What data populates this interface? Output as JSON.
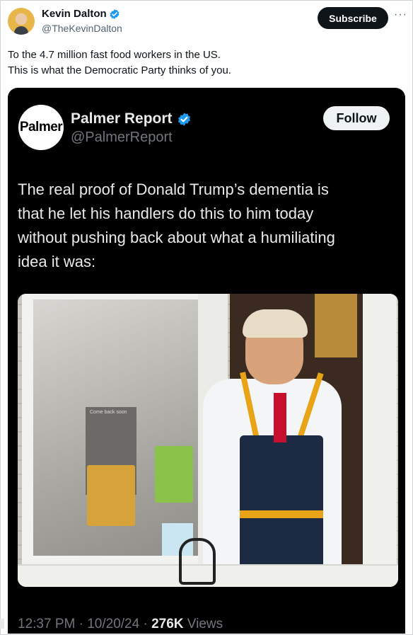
{
  "post": {
    "author": {
      "name": "Kevin Dalton",
      "handle": "@TheKevinDalton"
    },
    "subscribe_label": "Subscribe",
    "more_label": "···",
    "text_lines": [
      "To the 4.7 million fast food workers in the US.",
      "This is what the Democratic Party thinks of you."
    ]
  },
  "quoted": {
    "avatar_text": "Palmer",
    "author": {
      "name": "Palmer Report",
      "handle": "@PalmerReport"
    },
    "follow_label": "Follow",
    "text_lines": [
      "The real proof of Donald Trump’s dementia is",
      "that he let his handlers do this to him today",
      "without pushing back about what a humiliating",
      "idea it was:"
    ],
    "media": {
      "sign_text": "Come back soon"
    },
    "time": "12:37 PM",
    "separator": "·",
    "date": "10/20/24",
    "views_count": "276K",
    "views_label": "Views"
  },
  "colors": {
    "verified": "#1d9bf0",
    "accent_dark": "#0f1419"
  },
  "icons": {
    "verified": "verified-badge-icon",
    "more": "more-icon"
  }
}
